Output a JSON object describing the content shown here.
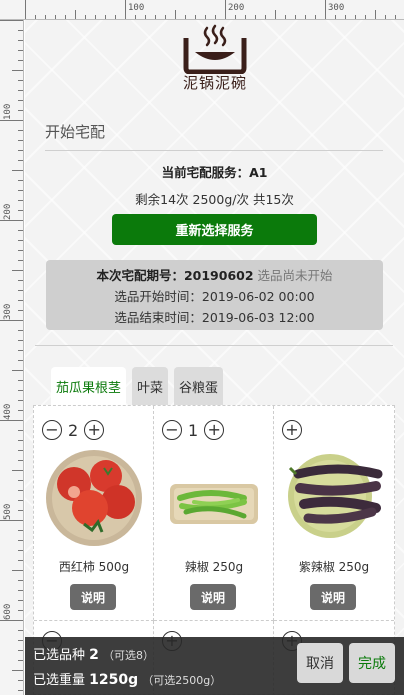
{
  "ruler": {
    "top_marks": [
      "100",
      "200",
      "300"
    ],
    "left_marks": [
      "100",
      "200",
      "300",
      "400",
      "500",
      "600"
    ]
  },
  "brand": {
    "name": "泥锅泥碗"
  },
  "section": {
    "title": "开始宅配"
  },
  "service": {
    "current_label": "当前宅配服务：A1",
    "detail": "剩余14次 2500g/次 共15次",
    "reselect_button": "重新选择服务"
  },
  "period": {
    "label": "本次宅配期号：",
    "number": "20190602",
    "status": "选品尚未开始",
    "start_time": "选品开始时间：2019-06-02 00:00",
    "end_time": "选品结束时间：2019-06-03 12:00"
  },
  "tabs": [
    {
      "label": "茄瓜果根茎",
      "active": true
    },
    {
      "label": "叶菜",
      "active": false
    },
    {
      "label": "谷粮蛋",
      "active": false
    }
  ],
  "products": [
    {
      "name": "西红柿 500g",
      "qty": "2",
      "info_label": "说明"
    },
    {
      "name": "辣椒 250g",
      "qty": "1",
      "info_label": "说明"
    },
    {
      "name": "紫辣椒 250g",
      "qty": "",
      "info_label": "说明"
    }
  ],
  "icons": {
    "minus": "−",
    "plus": "+"
  },
  "summary": {
    "kinds_label": "已选品种",
    "kinds_value": "2",
    "kinds_hint": "（可选8）",
    "weight_label": "已选重量",
    "weight_value": "1250g",
    "weight_hint": "（可选2500g）"
  },
  "actions": {
    "cancel": "取消",
    "done": "完成"
  },
  "colors": {
    "primary_green": "#0b7a0b",
    "info_button": "#6a6a6a",
    "panel_gray": "#cfcfcf"
  }
}
